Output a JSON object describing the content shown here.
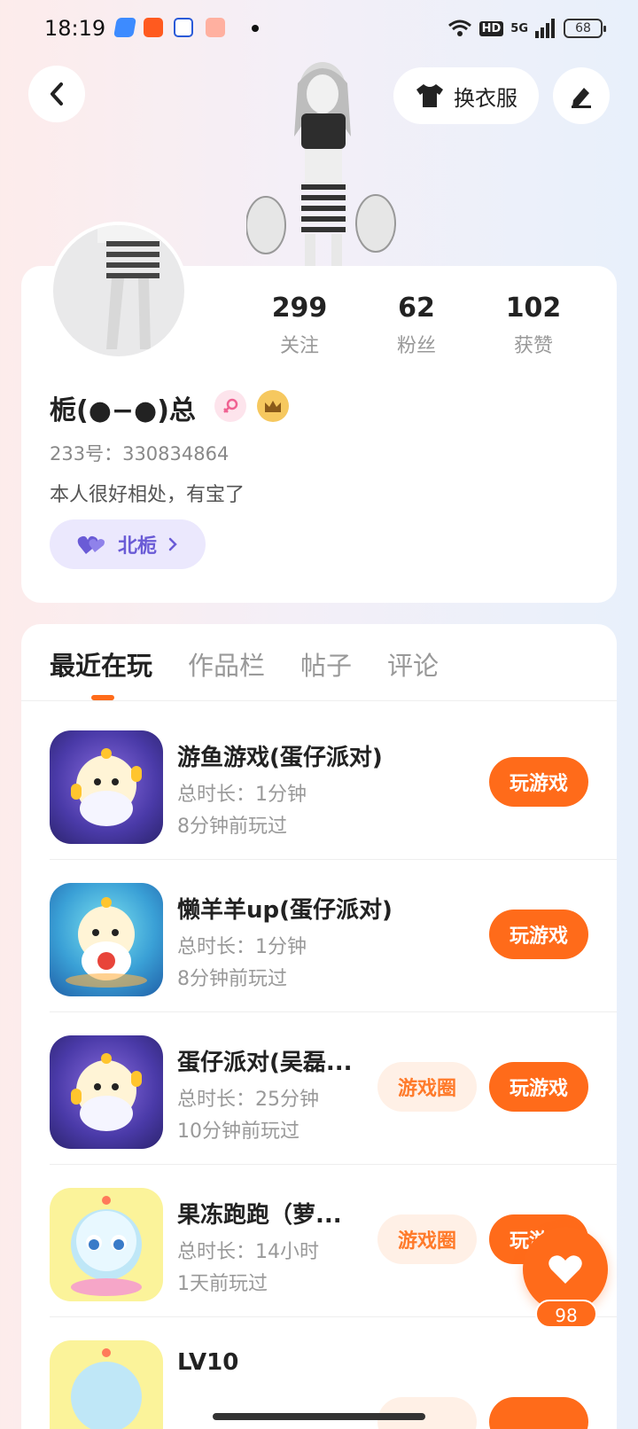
{
  "status_bar": {
    "time": "18:19",
    "hd": "HD",
    "network": "5G",
    "battery": "68"
  },
  "header": {
    "back_icon": "chevron-left-icon",
    "dress_label": "换衣服",
    "edit_icon": "pencil-icon"
  },
  "profile": {
    "stats": [
      {
        "num": "299",
        "label": "关注"
      },
      {
        "num": "62",
        "label": "粉丝"
      },
      {
        "num": "102",
        "label": "获赞"
      }
    ],
    "nickname": "栀(●−●)总",
    "uid": "233号：330834864",
    "bio": "本人很好相处，有宝了",
    "partner_chip": "北栀",
    "colors": {
      "accent": "#ff6b1a",
      "chip_text": "#6a5bd6",
      "chip_bg": "#ebe8fd"
    }
  },
  "tabs": [
    "最近在玩",
    "作品栏",
    "帖子",
    "评论"
  ],
  "games": [
    {
      "title": "游鱼游戏(蛋仔派对)",
      "duration": "总时长：1分钟",
      "last_played": "8分钟前玩过",
      "play": "玩游戏",
      "circle": ""
    },
    {
      "title": "懒羊羊up(蛋仔派对)",
      "duration": "总时长：1分钟",
      "last_played": "8分钟前玩过",
      "play": "玩游戏",
      "circle": ""
    },
    {
      "title": "蛋仔派对(吴磊...",
      "duration": "总时长：25分钟",
      "last_played": "10分钟前玩过",
      "play": "玩游戏",
      "circle": "游戏圈"
    },
    {
      "title": "果冻跑跑（萝...",
      "duration": "总时长：14小时",
      "last_played": "1天前玩过",
      "play": "玩游戏",
      "circle": "游戏圈"
    },
    {
      "title": "LV10",
      "duration": "",
      "last_played": "",
      "play": "",
      "circle": ""
    }
  ],
  "like_fab": {
    "count": "98"
  }
}
